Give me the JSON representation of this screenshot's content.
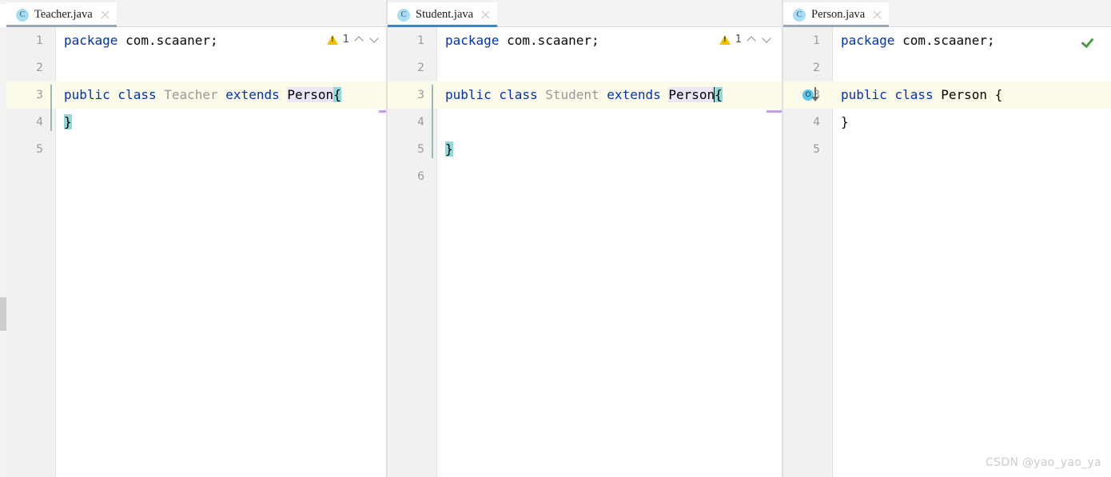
{
  "window": {
    "watermark": "CSDN @yao_yao_ya"
  },
  "colors": {
    "keyword": "#0033b3",
    "class_dim": "#999999",
    "reference_highlight": "#eae6f8",
    "brace_highlight": "#93d9d9",
    "current_line": "#fcfbe9",
    "tab_active_underline": "#4083c9",
    "tab_inactive_underline": "#9aa7b5",
    "warning": "#f2c200",
    "ok_check": "#4a9a4a",
    "gutter_bg": "#f1f1f1",
    "tabbar_bg": "#f2f2f2",
    "change_marker": "#c29ee8",
    "icon_class_bg": "#a6dff5"
  },
  "panes": [
    {
      "id": "teacher",
      "tab": {
        "icon": "java-class-icon",
        "title": "Teacher.java",
        "close_label": "close-icon",
        "state": "inactive-selected"
      },
      "inspection": {
        "type": "warning",
        "icon": "warning-triangle-icon",
        "count": "1",
        "prev_label": "prev-problem-icon",
        "next_label": "next-problem-icon"
      },
      "gutter_icon": null,
      "lines": [
        {
          "number": "1",
          "current": false,
          "tokens": [
            {
              "text": "package ",
              "style": "kw"
            },
            {
              "text": "com.scaaner;",
              "style": "plain"
            }
          ]
        },
        {
          "number": "2",
          "current": false,
          "tokens": []
        },
        {
          "number": "3",
          "current": true,
          "tokens": [
            {
              "text": "public class ",
              "style": "kw"
            },
            {
              "text": "Teacher ",
              "style": "classdim"
            },
            {
              "text": "extends ",
              "style": "kw"
            },
            {
              "text": "Person",
              "style": "hl-ref"
            },
            {
              "text": "{",
              "style": "hl-brace"
            }
          ]
        },
        {
          "number": "4",
          "current": false,
          "tokens": [
            {
              "text": "}",
              "style": "hl-brace"
            }
          ]
        },
        {
          "number": "5",
          "current": false,
          "tokens": []
        }
      ]
    },
    {
      "id": "student",
      "tab": {
        "icon": "java-class-icon",
        "title": "Student.java",
        "close_label": "close-icon",
        "state": "active-focused"
      },
      "inspection": {
        "type": "warning",
        "icon": "warning-triangle-icon",
        "count": "1",
        "prev_label": "prev-problem-icon",
        "next_label": "next-problem-icon"
      },
      "gutter_icon": null,
      "lines": [
        {
          "number": "1",
          "current": false,
          "tokens": [
            {
              "text": "package ",
              "style": "kw"
            },
            {
              "text": "com.scaaner;",
              "style": "plain"
            }
          ]
        },
        {
          "number": "2",
          "current": false,
          "tokens": []
        },
        {
          "number": "3",
          "current": true,
          "tokens": [
            {
              "text": "public class ",
              "style": "kw"
            },
            {
              "text": "Student ",
              "style": "classdim"
            },
            {
              "text": "extends ",
              "style": "kw"
            },
            {
              "text": "Person",
              "style": "hl-ref"
            },
            {
              "text": "CARET",
              "style": "caret"
            },
            {
              "text": "{",
              "style": "hl-brace"
            }
          ]
        },
        {
          "number": "4",
          "current": false,
          "tokens": []
        },
        {
          "number": "5",
          "current": false,
          "tokens": [
            {
              "text": "}",
              "style": "hl-brace"
            }
          ]
        },
        {
          "number": "6",
          "current": false,
          "tokens": []
        }
      ]
    },
    {
      "id": "person",
      "tab": {
        "icon": "java-class-icon",
        "title": "Person.java",
        "close_label": "close-icon",
        "state": "inactive-selected"
      },
      "inspection": {
        "type": "ok",
        "icon": "green-check-icon",
        "count": "",
        "prev_label": "",
        "next_label": ""
      },
      "gutter_icon": {
        "name": "overridden-by-subclass-icon",
        "glyph": "O",
        "line": "3"
      },
      "lines": [
        {
          "number": "1",
          "current": false,
          "tokens": [
            {
              "text": "package ",
              "style": "kw"
            },
            {
              "text": "com.scaaner;",
              "style": "plain"
            }
          ]
        },
        {
          "number": "2",
          "current": false,
          "tokens": []
        },
        {
          "number": "3",
          "current": true,
          "tokens": [
            {
              "text": "public class ",
              "style": "kw"
            },
            {
              "text": "Person ",
              "style": "ident"
            },
            {
              "text": "{",
              "style": "plain"
            }
          ]
        },
        {
          "number": "4",
          "current": false,
          "tokens": [
            {
              "text": "}",
              "style": "plain"
            }
          ]
        },
        {
          "number": "5",
          "current": false,
          "tokens": []
        }
      ]
    }
  ]
}
